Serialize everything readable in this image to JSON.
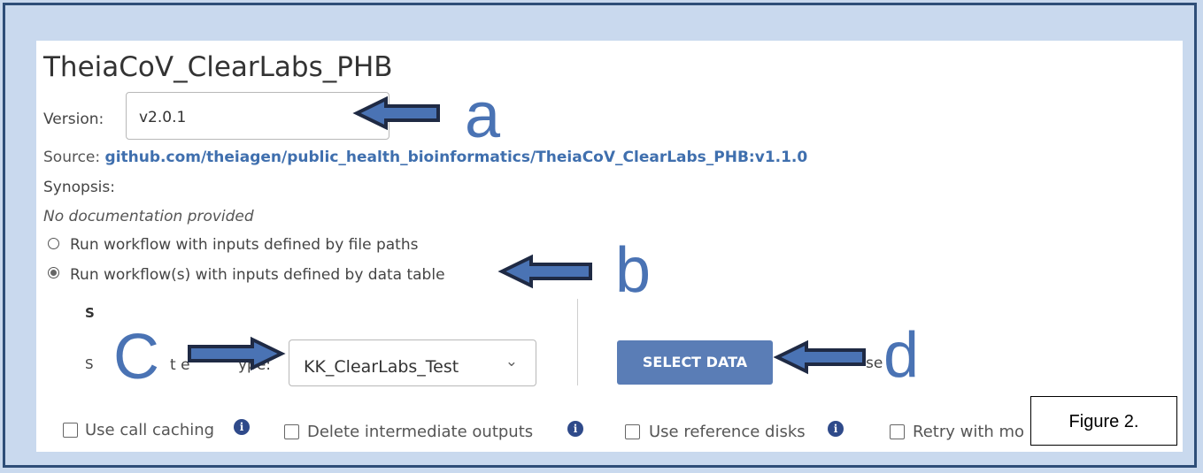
{
  "workflow": {
    "title": "TheiaCoV_ClearLabs_PHB",
    "version_label": "Version:",
    "version_value": "v2.0.1",
    "source_label": "Source:",
    "source_link": "github.com/theiagen/public_health_bioinformatics/TheiaCoV_ClearLabs_PHB:v1.1.0",
    "synopsis_label": "Synopsis:",
    "synopsis_text": "No documentation provided"
  },
  "run_options": {
    "file_paths_label": "Run workflow with inputs defined by file paths",
    "data_table_label": "Run workflow(s) with inputs defined by data table",
    "selected": "data_table"
  },
  "data_section": {
    "heading_fragment": "S",
    "select_fragment": "S",
    "type_fragment_1": "t e",
    "type_fragment_2": "ype:",
    "table_value": "KK_ClearLabs_Test",
    "select_data_button": "SELECT DATA",
    "right_fragment": "se"
  },
  "checkbox_options": [
    {
      "label": "Use call caching",
      "checked": false
    },
    {
      "label": "Delete intermediate outputs",
      "checked": false
    },
    {
      "label": "Use reference disks",
      "checked": false
    },
    {
      "label": "Retry with mo",
      "checked": false
    }
  ],
  "annotations": {
    "callout_a": "a",
    "callout_b": "b",
    "callout_c": "C",
    "callout_d": "d",
    "figure_label": "Figure 2.",
    "arrow_color": "#4a73b4",
    "arrow_outline": "#1f2a44"
  },
  "icons": {
    "dropdown": "chevron-down-icon",
    "info": "info-icon",
    "arrow": "arrow-icon"
  }
}
